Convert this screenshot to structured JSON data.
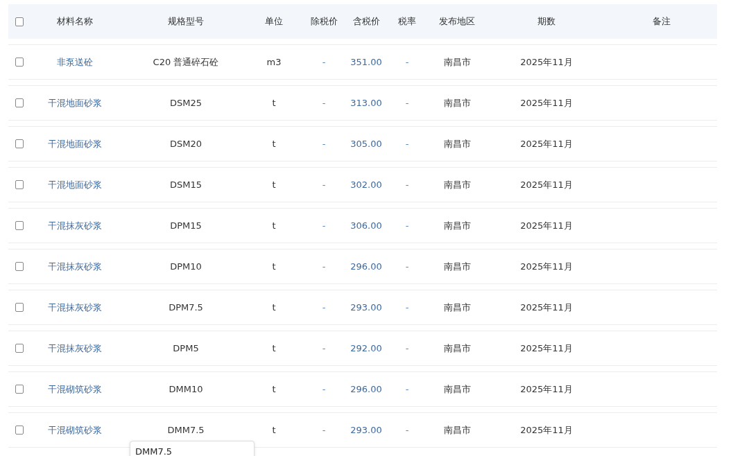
{
  "table": {
    "header_checkbox": {
      "checked": false
    },
    "columns": [
      "材料名称",
      "规格型号",
      "单位",
      "除税价",
      "含税价",
      "税率",
      "发布地区",
      "期数",
      "备注"
    ],
    "rows": [
      {
        "checked": false,
        "name": "非泵送砼",
        "spec": "C20 普通碎石砼",
        "unit": "m3",
        "pre_tax_price": "-",
        "tax_incl_price": "351.00",
        "tax_rate": "-",
        "region": "南昌市",
        "period": "2025年11月"
      },
      {
        "checked": false,
        "name": "干混地面砂浆",
        "spec": "DSM25",
        "unit": "t",
        "pre_tax_price": "-",
        "tax_incl_price": "313.00",
        "tax_rate": "-",
        "region": "南昌市",
        "period": "2025年11月"
      },
      {
        "checked": false,
        "name": "干混地面砂浆",
        "spec": "DSM20",
        "unit": "t",
        "pre_tax_price": "-",
        "tax_incl_price": "305.00",
        "tax_rate": "-",
        "region": "南昌市",
        "period": "2025年11月"
      },
      {
        "checked": false,
        "name": "干混地面砂浆",
        "spec": "DSM15",
        "unit": "t",
        "pre_tax_price": "-",
        "tax_incl_price": "302.00",
        "tax_rate": "-",
        "region": "南昌市",
        "period": "2025年11月"
      },
      {
        "checked": false,
        "name": "干混抹灰砂浆",
        "spec": "DPM15",
        "unit": "t",
        "pre_tax_price": "-",
        "tax_incl_price": "306.00",
        "tax_rate": "-",
        "region": "南昌市",
        "period": "2025年11月"
      },
      {
        "checked": false,
        "name": "干混抹灰砂浆",
        "spec": "DPM10",
        "unit": "t",
        "pre_tax_price": "-",
        "tax_incl_price": "296.00",
        "tax_rate": "-",
        "region": "南昌市",
        "period": "2025年11月"
      },
      {
        "checked": false,
        "name": "干混抹灰砂浆",
        "spec": "DPM7.5",
        "unit": "t",
        "pre_tax_price": "-",
        "tax_incl_price": "293.00",
        "tax_rate": "-",
        "region": "南昌市",
        "period": "2025年11月"
      },
      {
        "checked": false,
        "name": "干混抹灰砂浆",
        "spec": "DPM5",
        "unit": "t",
        "pre_tax_price": "-",
        "tax_incl_price": "292.00",
        "tax_rate": "-",
        "region": "南昌市",
        "period": "2025年11月"
      },
      {
        "checked": false,
        "name": "干混砌筑砂浆",
        "spec": "DMM10",
        "unit": "t",
        "pre_tax_price": "-",
        "tax_incl_price": "296.00",
        "tax_rate": "-",
        "region": "南昌市",
        "period": "2025年11月"
      },
      {
        "checked": false,
        "name": "干混砌筑砂浆",
        "spec": "DMM7.5",
        "unit": "t",
        "pre_tax_price": "-",
        "tax_incl_price": "293.00",
        "tax_rate": "-",
        "region": "南昌市",
        "period": "2025年11月"
      }
    ]
  },
  "tooltip": {
    "text": "DMM7.5"
  }
}
